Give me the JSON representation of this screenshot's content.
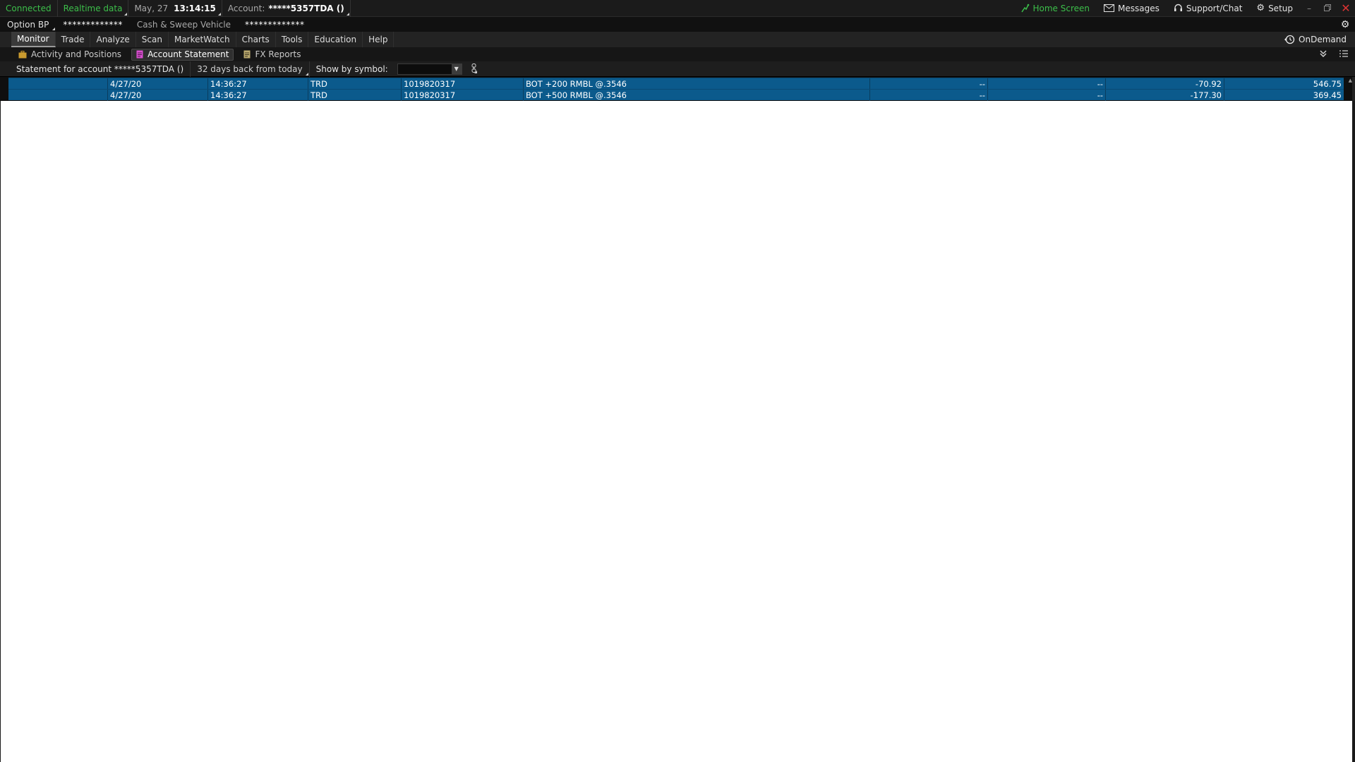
{
  "status_bar": {
    "connected": "Connected",
    "realtime": "Realtime data",
    "date": "May, 27",
    "time": "13:14:15",
    "account_label": "Account:",
    "account_value": "*****5357TDA ()",
    "home_screen": "Home Screen",
    "messages": "Messages",
    "support": "Support/Chat",
    "setup": "Setup"
  },
  "info_bar": {
    "option_bp_label": "Option BP",
    "option_bp_value": "*************",
    "cash_sweep_label": "Cash & Sweep Vehicle",
    "cash_sweep_value": "*************"
  },
  "menu": {
    "items": [
      "Monitor",
      "Trade",
      "Analyze",
      "Scan",
      "MarketWatch",
      "Charts",
      "Tools",
      "Education",
      "Help"
    ],
    "active": "Monitor",
    "ondemand": "OnDemand"
  },
  "sub_tabs": {
    "items": [
      "Activity and Positions",
      "Account Statement",
      "FX Reports"
    ],
    "active": "Account Statement"
  },
  "statement_bar": {
    "statement_for": "Statement for account *****5357TDA ()",
    "period": "32 days back from today",
    "show_by_symbol": "Show by symbol:",
    "symbol_value": ""
  },
  "table": {
    "rows": [
      [
        "",
        "4/27/20",
        "14:36:27",
        "TRD",
        "1019820317",
        "BOT +200 RMBL @.3546",
        "--",
        "--",
        "-70.92",
        "546.75"
      ],
      [
        "",
        "4/27/20",
        "14:36:27",
        "TRD",
        "1019820317",
        "BOT +500 RMBL @.3546",
        "--",
        "--",
        "-177.30",
        "369.45"
      ]
    ]
  },
  "colors": {
    "accent_green": "#3cbf4a",
    "row_selected": "#0b5a8c",
    "close_red": "#dd3333",
    "account_statement_icon": "#d94fd0",
    "activity_icon": "#c99a2e"
  }
}
